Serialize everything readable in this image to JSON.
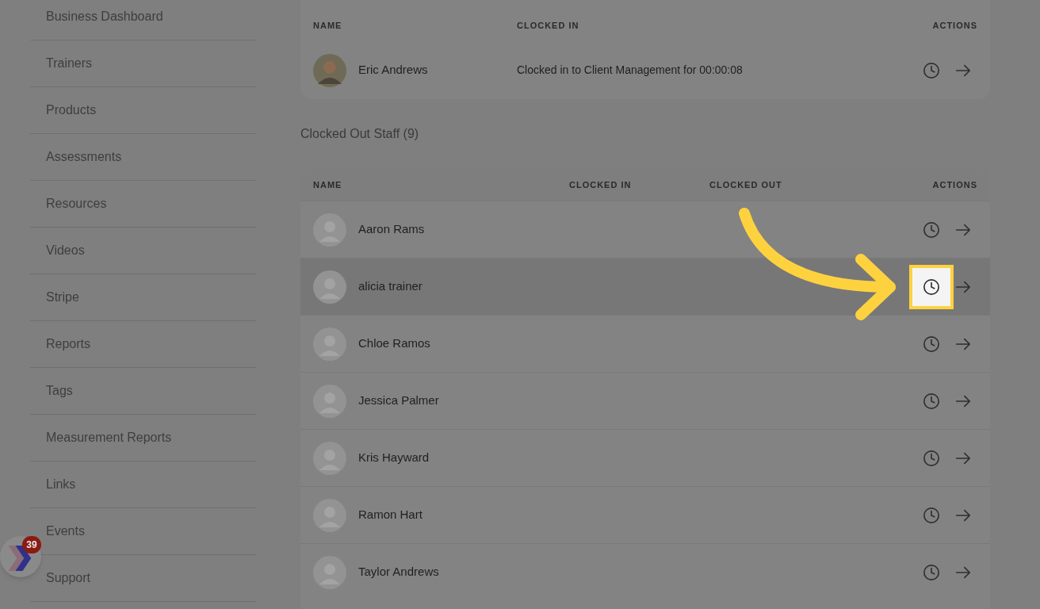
{
  "sidebar": {
    "items": [
      {
        "label": "Business Dashboard"
      },
      {
        "label": "Trainers"
      },
      {
        "label": "Products"
      },
      {
        "label": "Assessments"
      },
      {
        "label": "Resources"
      },
      {
        "label": "Videos"
      },
      {
        "label": "Stripe"
      },
      {
        "label": "Reports"
      },
      {
        "label": "Tags"
      },
      {
        "label": "Measurement Reports"
      },
      {
        "label": "Links"
      },
      {
        "label": "Events"
      },
      {
        "label": "Support"
      }
    ]
  },
  "widget": {
    "badge": "39"
  },
  "clocked_in": {
    "columns": [
      "NAME",
      "CLOCKED IN",
      "ACTIONS"
    ],
    "rows": [
      {
        "name": "Eric Andrews",
        "status": "Clocked in to Client Management for 00:00:08",
        "kind": "photo"
      }
    ]
  },
  "clocked_out": {
    "title": "Clocked Out Staff (9)",
    "columns": [
      "NAME",
      "CLOCKED IN",
      "CLOCKED OUT",
      "ACTIONS"
    ],
    "rows": [
      {
        "name": "Aaron Rams",
        "kind": "default",
        "selected": false
      },
      {
        "name": "alicia trainer",
        "kind": "default",
        "selected": true
      },
      {
        "name": "Chloe Ramos",
        "kind": "default",
        "selected": false
      },
      {
        "name": "Jessica Palmer",
        "kind": "default",
        "selected": false
      },
      {
        "name": "Kris Hayward",
        "kind": "default",
        "selected": false
      },
      {
        "name": "Ramon Hart",
        "kind": "default",
        "selected": false
      },
      {
        "name": "Taylor Andrews",
        "kind": "default",
        "selected": false
      }
    ]
  }
}
